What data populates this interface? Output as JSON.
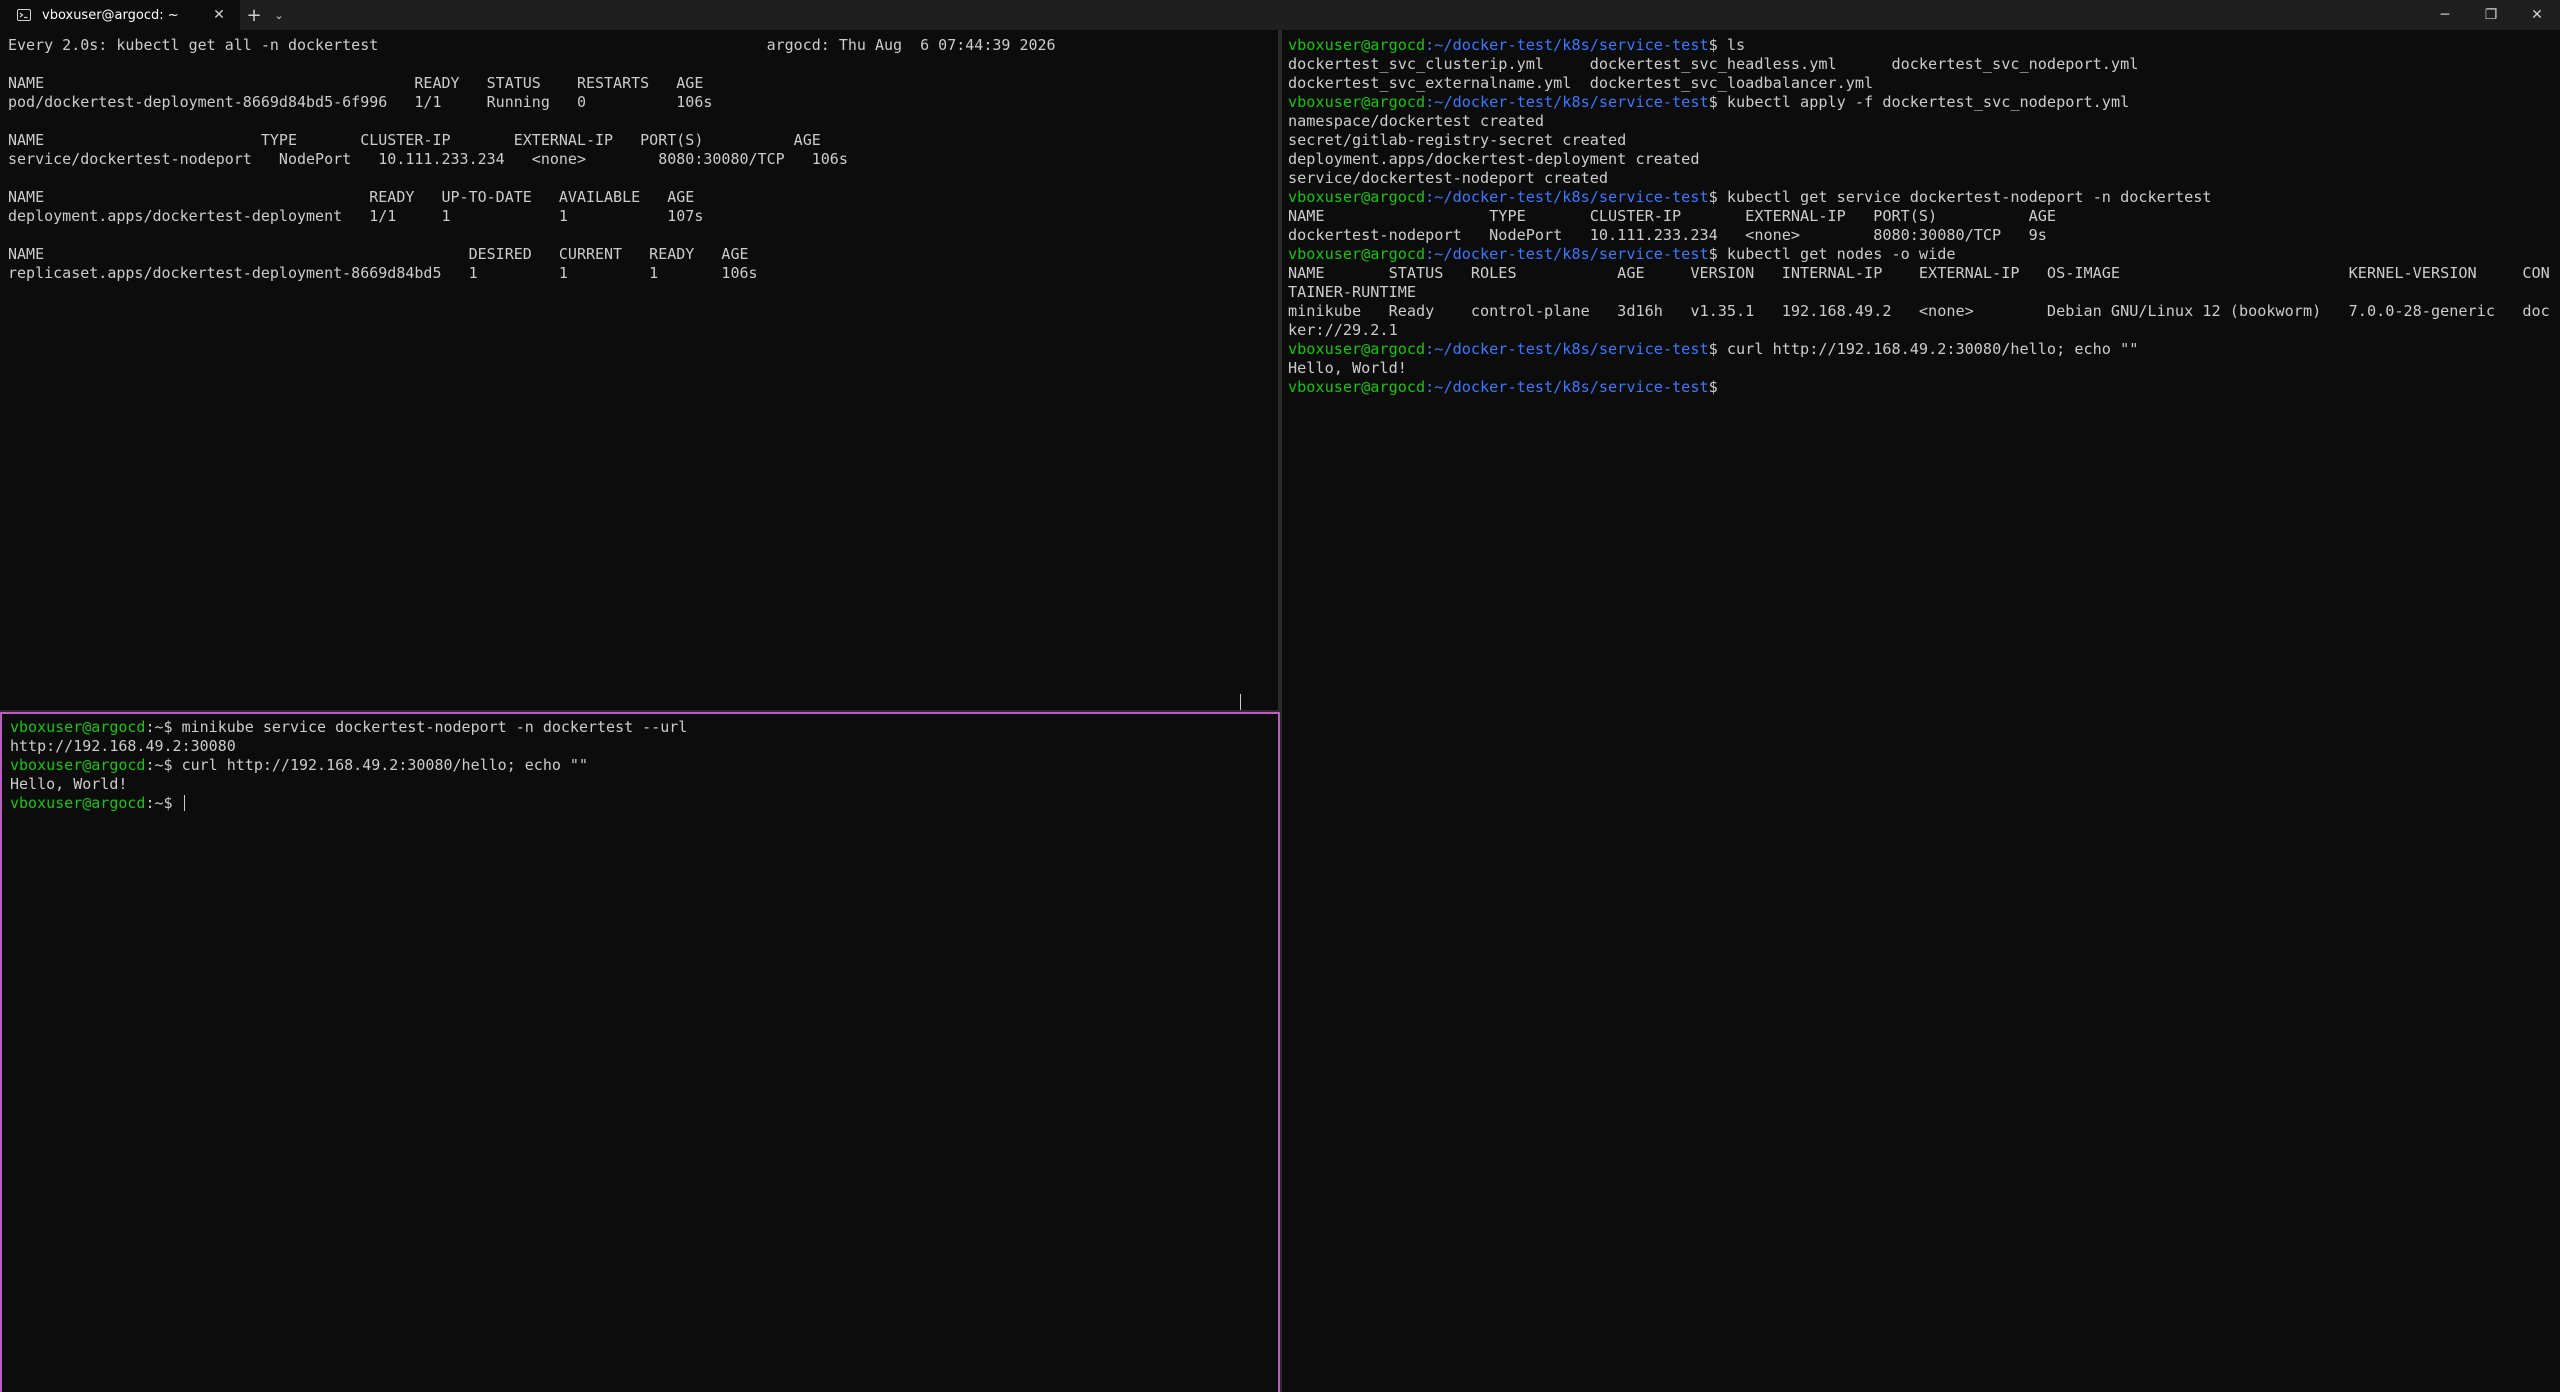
{
  "tab": {
    "title": "vboxuser@argocd: ~",
    "close": "✕"
  },
  "titlebar": {
    "new_tab": "+",
    "dropdown": "⌄"
  },
  "window": {
    "minimize": "─",
    "restore": "❐",
    "close": "✕"
  },
  "prompt": {
    "user_host": "vboxuser@argocd",
    "home_path": ":~",
    "k8s_path": ":~/docker-test/k8s/service-test",
    "symbol": "$ "
  },
  "top_left": {
    "lines": [
      "Every 2.0s: kubectl get all -n dockertest                                           argocd: Thu Aug  6 07:44:39 2026",
      "",
      "NAME                                         READY   STATUS    RESTARTS   AGE",
      "pod/dockertest-deployment-8669d84bd5-6f996   1/1     Running   0          106s",
      "",
      "NAME                        TYPE       CLUSTER-IP       EXTERNAL-IP   PORT(S)          AGE",
      "service/dockertest-nodeport   NodePort   10.111.233.234   <none>        8080:30080/TCP   106s",
      "",
      "NAME                                    READY   UP-TO-DATE   AVAILABLE   AGE",
      "deployment.apps/dockertest-deployment   1/1     1            1           107s",
      "",
      "NAME                                               DESIRED   CURRENT   READY   AGE",
      "replicaset.apps/dockertest-deployment-8669d84bd5   1         1         1       106s"
    ]
  },
  "bottom_left": {
    "cmd1": "minikube service dockertest-nodeport -n dockertest --url",
    "out1": "http://192.168.49.2:30080",
    "cmd2": "curl http://192.168.49.2:30080/hello; echo \"\"",
    "out2": "Hello, World!"
  },
  "right": {
    "cmd_ls": "ls",
    "ls_out1": "dockertest_svc_clusterip.yml     dockertest_svc_headless.yml      dockertest_svc_nodeport.yml",
    "ls_out2": "dockertest_svc_externalname.yml  dockertest_svc_loadbalancer.yml",
    "cmd_apply": "kubectl apply -f dockertest_svc_nodeport.yml",
    "apply_out1": "namespace/dockertest created",
    "apply_out2": "secret/gitlab-registry-secret created",
    "apply_out3": "deployment.apps/dockertest-deployment created",
    "apply_out4": "service/dockertest-nodeport created",
    "cmd_svc": "kubectl get service dockertest-nodeport -n dockertest",
    "svc_head": "NAME                  TYPE       CLUSTER-IP       EXTERNAL-IP   PORT(S)          AGE",
    "svc_row": "dockertest-nodeport   NodePort   10.111.233.234   <none>        8080:30080/TCP   9s",
    "cmd_nodes": "kubectl get nodes -o wide",
    "nodes_head": "NAME       STATUS   ROLES           AGE     VERSION   INTERNAL-IP    EXTERNAL-IP   OS-IMAGE                         KERNEL-VERSION     CON",
    "nodes_head_wrap": "TAINER-RUNTIME",
    "nodes_row": "minikube   Ready    control-plane   3d16h   v1.35.1   192.168.49.2   <none>        Debian GNU/Linux 12 (bookworm)   7.0.0-28-generic   doc",
    "nodes_row_wrap": "ker://29.2.1",
    "cmd_curl": "curl http://192.168.49.2:30080/hello; echo \"\"",
    "curl_out": "Hello, World!"
  }
}
